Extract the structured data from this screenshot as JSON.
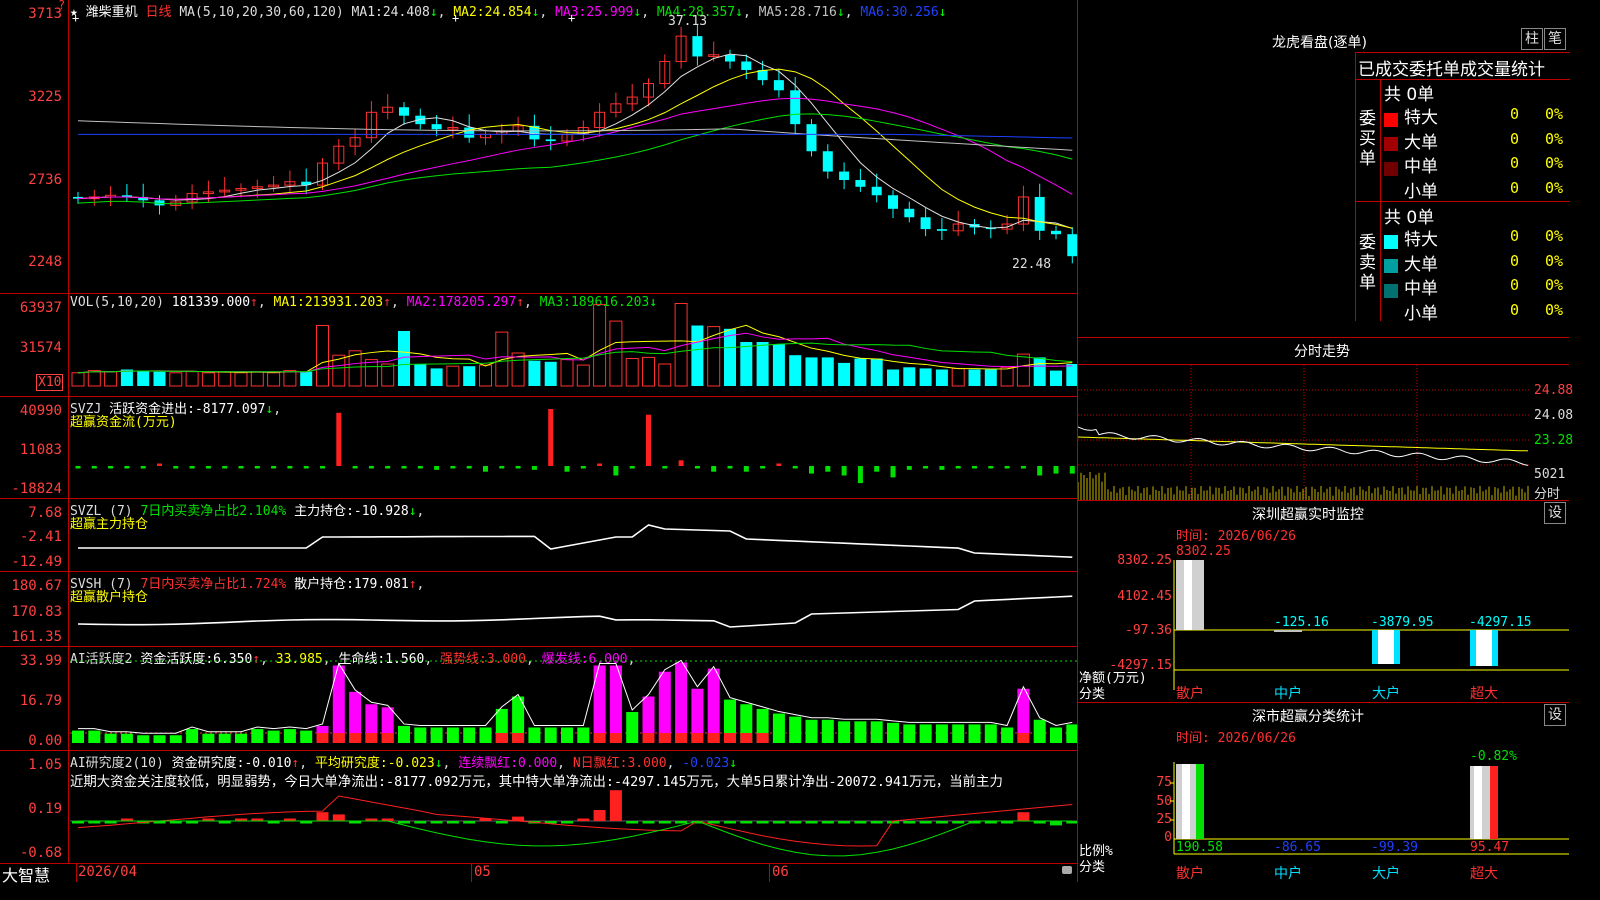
{
  "main": {
    "title": "潍柴重机",
    "period": "日线",
    "ma_prefix": "MA(5,10,20,30,60,120)",
    "ma_items": [
      {
        "label": "MA1:",
        "value": "24.408",
        "color": "#e0e0e0"
      },
      {
        "label": "MA2:",
        "value": "24.854",
        "color": "#ffff00"
      },
      {
        "label": "MA3:",
        "value": "25.999",
        "color": "#ff00ff"
      },
      {
        "label": "MA4:",
        "value": "28.357",
        "color": "#00e000"
      },
      {
        "label": "MA5:",
        "value": "28.716",
        "color": "#c0c0c0"
      },
      {
        "label": "MA6:",
        "value": "30.256",
        "color": "#2040ff"
      }
    ],
    "y_ticks": [
      "3713",
      "3225",
      "2736",
      "2248"
    ],
    "high_label": "37.13",
    "low_label": "22.48"
  },
  "vol": {
    "legend_prefix": "VOL(5,10,20)",
    "value": "181339.000",
    "ma_items": [
      {
        "label": "MA1:",
        "value": "213931.203",
        "color": "#ffff00"
      },
      {
        "label": "MA2:",
        "value": "178205.297",
        "color": "#ff00ff"
      },
      {
        "label": "MA3:",
        "value": "189616.203",
        "color": "#00e000"
      }
    ],
    "y_ticks": [
      "63937",
      "31574"
    ],
    "unit": "X10"
  },
  "svzj": {
    "name": "SVZJ",
    "label": "活跃资金进出:",
    "value": "-8177.097",
    "sub": "超赢资金流(万元)",
    "y_ticks": [
      "40990",
      "11083",
      "-18824"
    ]
  },
  "svzl": {
    "name": "SVZL (7)",
    "text1": "7日内买卖净占比2.104%",
    "label": "主力持仓:",
    "value": "-10.928",
    "sub": "超赢主力持仓",
    "y_ticks": [
      "7.68",
      "-2.41",
      "-12.49"
    ]
  },
  "svsh": {
    "name": "SVSH (7)",
    "text1": "7日内买卖净占比1.724%",
    "label": "散户持仓:",
    "value": "179.081",
    "sub": "超赢散户持仓",
    "y_ticks": [
      "180.67",
      "170.83",
      "161.35"
    ]
  },
  "ai_active": {
    "name": "AI活跃度2",
    "label": "资金活跃度:",
    "value": "6.350",
    "value2": "33.985",
    "label2": "生命线:",
    "value3": "1.560",
    "label3": "强势线:",
    "value4": "3.000",
    "label4": "爆发线:",
    "value5": "6.000",
    "y_ticks": [
      "33.99",
      "16.79",
      "0.00"
    ]
  },
  "ai_research": {
    "name": "AI研究度2(10)",
    "label": "资金研究度:",
    "value": "-0.010",
    "label2": "平均研究度:",
    "value2": "-0.023",
    "label3": "连续飘红:",
    "value3": "0.000",
    "label4": "N日飘红:",
    "value4": "3.000",
    "value5": "-0.023",
    "summary": "近期大资金关注度较低，明显弱势，今日大单净流出:-8177.092万元，其中特大单净流出:-4297.145万元，大单5日累计净出-20072.941万元，当前主力",
    "y_ticks": [
      "1.05",
      "0.19",
      "-0.68"
    ]
  },
  "footer": {
    "brand": "大智慧",
    "date": "2026/04",
    "month2": "05",
    "month3": "06"
  },
  "right": {
    "lhb_title": "龙虎看盘(逐单)",
    "btn_zhu": "柱",
    "btn_bi": "笔",
    "stats_title": "已成交委托单成交量统计",
    "buy_side": "委买单",
    "sell_side": "委卖单",
    "total_buy": "共 0单",
    "total_sell": "共 0单",
    "buy_rows": [
      {
        "name": "特大",
        "count": "0",
        "pct": "0%",
        "color": "#ff0000"
      },
      {
        "name": "大单",
        "count": "0",
        "pct": "0%",
        "color": "#a00000"
      },
      {
        "name": "中单",
        "count": "0",
        "pct": "0%",
        "color": "#700000"
      },
      {
        "name": "小单",
        "count": "0",
        "pct": "0%",
        "color": ""
      }
    ],
    "sell_rows": [
      {
        "name": "特大",
        "count": "0",
        "pct": "0%",
        "color": "#00ffff"
      },
      {
        "name": "大单",
        "count": "0",
        "pct": "0%",
        "color": "#00a0a0"
      },
      {
        "name": "中单",
        "count": "0",
        "pct": "0%",
        "color": "#007070"
      },
      {
        "name": "小单",
        "count": "0",
        "pct": "0%",
        "color": ""
      }
    ],
    "intraday_title": "分时走势",
    "intraday_ticks": [
      "24.88",
      "24.08",
      "23.28"
    ],
    "intraday_vol": "5021",
    "intraday_unit": "分时",
    "monitor_title": "深圳超赢实时监控",
    "monitor_btn": "设",
    "monitor_time": "时间: 2026/06/26",
    "monitor_ticks": [
      "8302.25",
      "4102.45",
      "-97.36",
      "-4297.15"
    ],
    "monitor_top": "8302.25",
    "monitor_values": [
      "-125.16",
      "-3879.95",
      "-4297.15"
    ],
    "monitor_ylabel": "净额(万元)",
    "monitor_xlabel": "分类",
    "categories": [
      "散户",
      "中户",
      "大户",
      "超大"
    ],
    "stat_title": "深市超赢分类统计",
    "stat_btn": "设",
    "stat_time": "时间: 2026/06/26",
    "stat_ticks": [
      "75",
      "50",
      "25",
      "0"
    ],
    "stat_top": "-0.82%",
    "stat_values": [
      "190.58",
      "-86.65",
      "-99.39",
      "95.47"
    ],
    "stat_ylabel": "比例%",
    "stat_xlabel": "分类"
  }
}
